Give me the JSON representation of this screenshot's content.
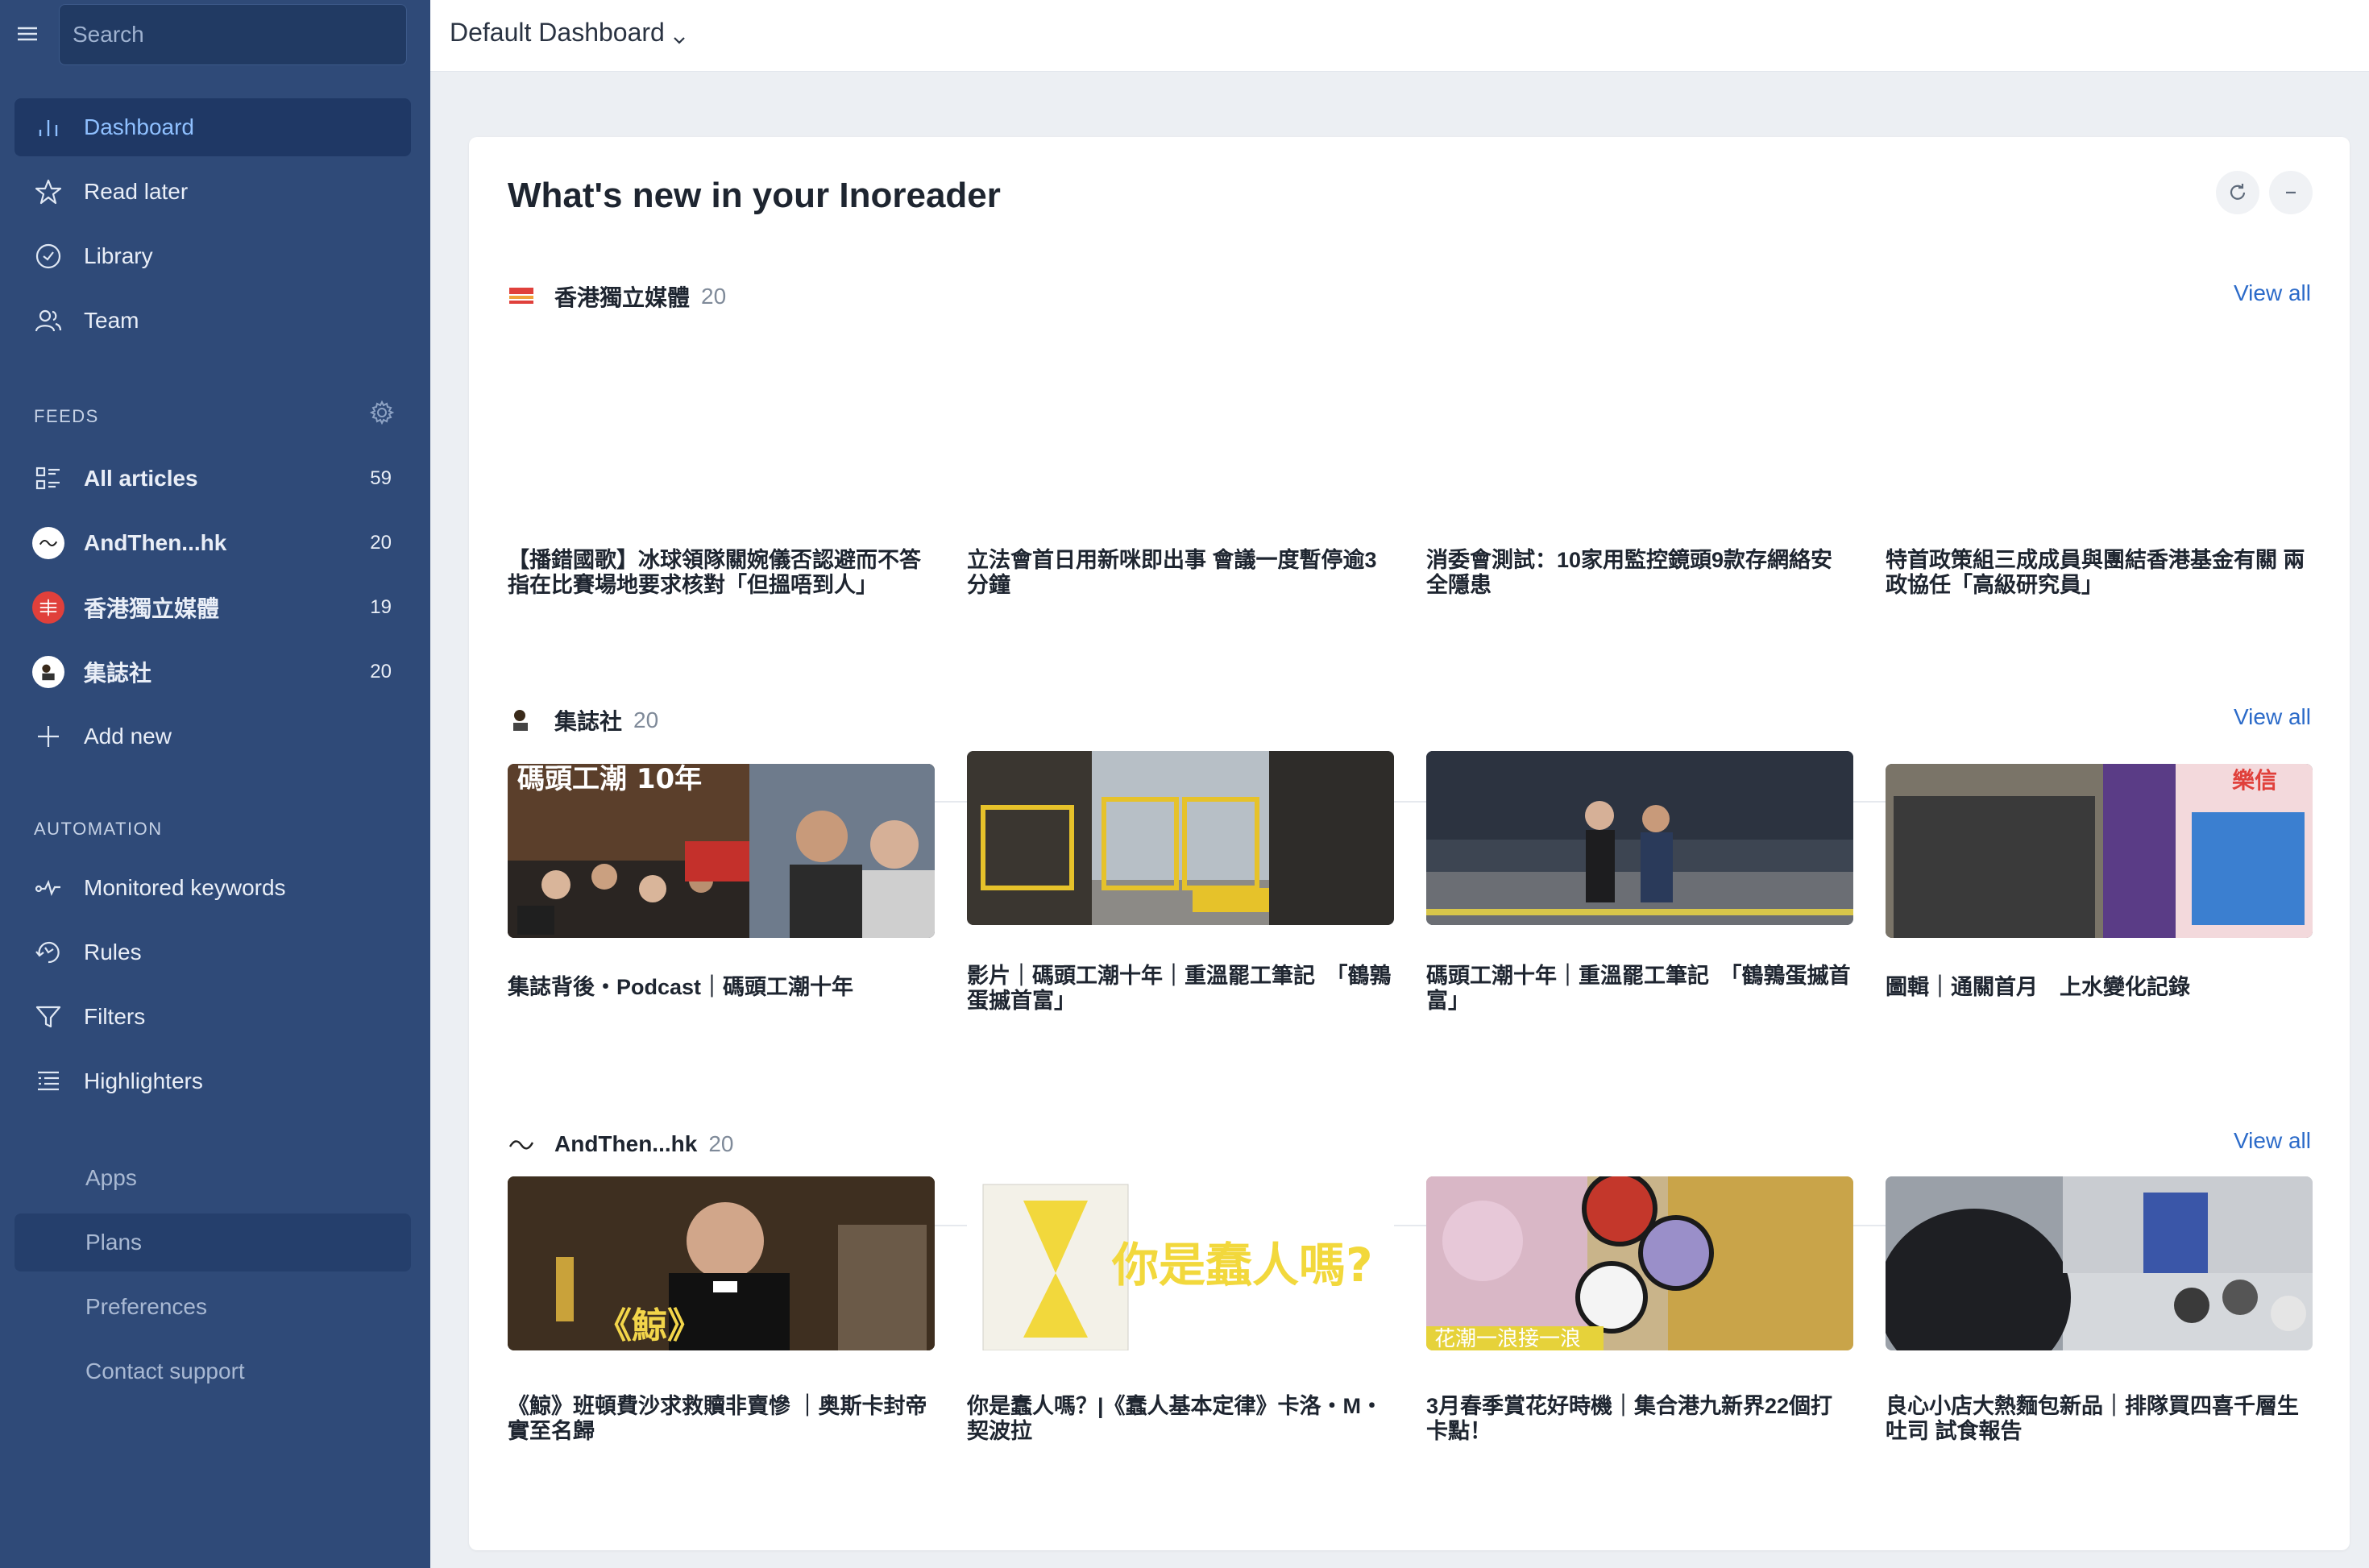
{
  "sidebar": {
    "search_placeholder": "Search",
    "nav": [
      {
        "label": "Dashboard",
        "icon": "bar-chart-icon",
        "active": true
      },
      {
        "label": "Read later",
        "icon": "star-icon"
      },
      {
        "label": "Library",
        "icon": "check-circle-icon"
      },
      {
        "label": "Team",
        "icon": "team-icon"
      }
    ],
    "feeds_label": "FEEDS",
    "feeds": [
      {
        "label": "All articles",
        "count": "59",
        "icon": "list-icon"
      },
      {
        "label": "AndThen...hk",
        "count": "20",
        "icon": "andthen-avatar"
      },
      {
        "label": "香港獨立媒體",
        "count": "19",
        "icon": "inmedia-avatar"
      },
      {
        "label": "集誌社",
        "count": "20",
        "icon": "thecollective-avatar"
      }
    ],
    "add_new": "Add new",
    "automation_label": "AUTOMATION",
    "automation": [
      {
        "label": "Monitored keywords",
        "icon": "pulse-icon"
      },
      {
        "label": "Rules",
        "icon": "rules-icon"
      },
      {
        "label": "Filters",
        "icon": "filter-icon"
      },
      {
        "label": "Highlighters",
        "icon": "highlighter-icon"
      }
    ],
    "bottom": [
      {
        "label": "Apps"
      },
      {
        "label": "Plans",
        "active": true
      },
      {
        "label": "Preferences"
      },
      {
        "label": "Contact support"
      }
    ]
  },
  "topbar": {
    "title": "Default Dashboard"
  },
  "card": {
    "title": "What's new in your Inoreader",
    "view_all": "View all",
    "sections": [
      {
        "name": "香港獨立媒體",
        "count": "20",
        "articles": [
          {
            "title": "【播錯國歌】冰球領隊關婉儀否認避而不答 指在比賽場地要求核對「但搵唔到人」"
          },
          {
            "title": "立法會首日用新咪即出事 會議一度暫停逾3分鐘"
          },
          {
            "title": "消委會測試：10家用監控鏡頭9款存網絡安全隱患"
          },
          {
            "title": "特首政策組三成成員與團結香港基金有關 兩政協任「高級研究員」"
          }
        ]
      },
      {
        "name": "集誌社",
        "count": "20",
        "articles": [
          {
            "title": "集誌背後・Podcast｜碼頭工潮十年",
            "thumb_text": "碼頭工潮 10年"
          },
          {
            "title": "影片｜碼頭工潮十年｜重溫罷工筆記　「鶴鶉蛋摵首富」"
          },
          {
            "title": "碼頭工潮十年｜重溫罷工筆記　「鶴鶉蛋摵首富」"
          },
          {
            "title": "圖輯｜通關首月　上水變化記錄",
            "thumb_text": "樂信"
          }
        ]
      },
      {
        "name": "AndThen...hk",
        "count": "20",
        "articles": [
          {
            "title": "《鯨》班頓費沙求救贖非賣慘 ｜奥斯卡封帝實至名歸",
            "thumb_text": "《鯨》"
          },
          {
            "title": "你是蠢人嗎？|《蠢人基本定律》卡洛・M・契波拉",
            "thumb_text": "你是蠢人嗎?"
          },
          {
            "title": "3月春季賞花好時機｜集合港九新界22個打卡點！",
            "thumb_text": "花潮一浪接一浪"
          },
          {
            "title": "良心小店大熱麵包新品｜排隊買四喜千層生吐司 試食報告"
          }
        ]
      }
    ]
  }
}
